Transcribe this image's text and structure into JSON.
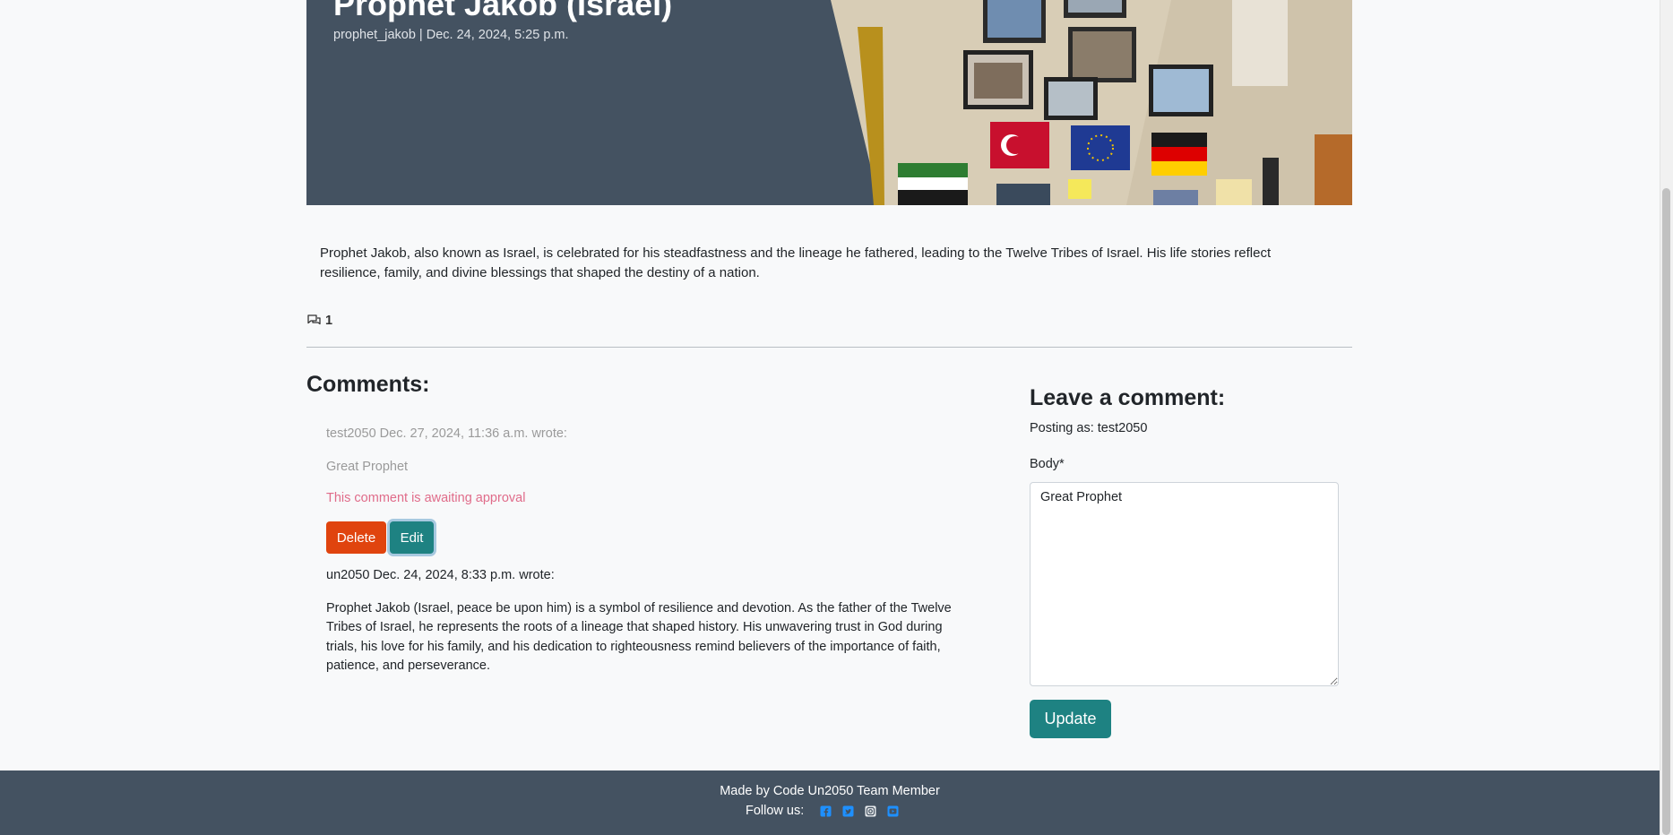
{
  "post": {
    "title": "Prophet Jakob (Israel)",
    "meta": "prophet_jakob | Dec. 24, 2024, 5:25 p.m.",
    "body": "Prophet Jakob, also known as Israel, is celebrated for his steadfastness and the lineage he fathered, leading to the Twelve Tribes of Israel. His life stories reflect resilience, family, and divine blessings that shaped the destiny of a nation.",
    "comment_count": "1"
  },
  "comments": {
    "heading": "Comments:",
    "items": [
      {
        "meta": "test2050 Dec. 27, 2024, 11:36 a.m. wrote:",
        "text": "Great Prophet",
        "pending_note": "This comment is awaiting approval",
        "delete_label": "Delete",
        "edit_label": "Edit"
      },
      {
        "meta": "un2050 Dec. 24, 2024, 8:33 p.m. wrote:",
        "text": "Prophet Jakob (Israel, peace be upon him) is a symbol of resilience and devotion. As the father of the Twelve Tribes of Israel, he represents the roots of a lineage that shaped history. His unwavering trust in God during trials, his love for his family, and his dedication to righteousness remind believers of the importance of faith, patience, and perseverance."
      }
    ]
  },
  "form": {
    "heading": "Leave a comment:",
    "posting_as": "Posting as: test2050",
    "body_label": "Body*",
    "body_value": "Great Prophet",
    "submit_label": "Update"
  },
  "footer": {
    "credit": "Made by Code Un2050 Team Member",
    "follow_label": "Follow us:",
    "social_icons": [
      "facebook-icon",
      "twitter-icon",
      "instagram-icon",
      "youtube-icon"
    ]
  },
  "colors": {
    "masthead_bg": "#445261",
    "delete_button": "#e0440e",
    "edit_button": "#1e8282",
    "update_button": "#1e8282",
    "pending_text": "#e06c8a",
    "social_icon": "#1e90ff"
  }
}
